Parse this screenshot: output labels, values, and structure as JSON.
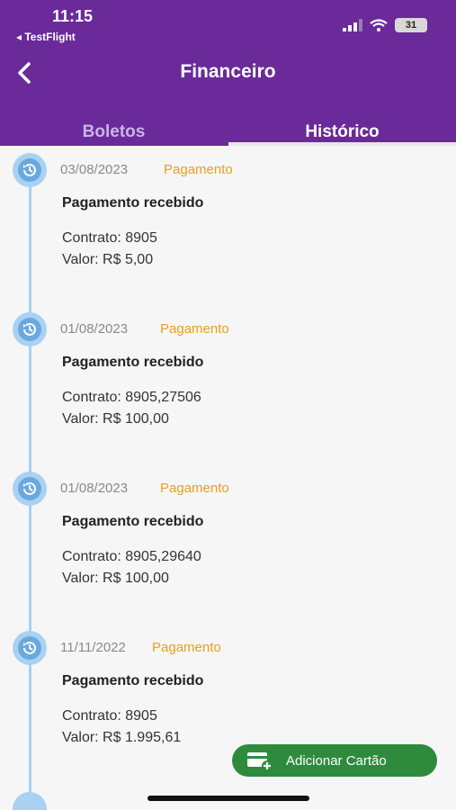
{
  "status_bar": {
    "time": "11:15",
    "back_app": "◂ TestFlight",
    "battery": "31"
  },
  "header": {
    "title": "Financeiro",
    "back_icon": "chevron-left-icon"
  },
  "tabs": [
    {
      "label": "Boletos",
      "selected": false
    },
    {
      "label": "Histórico",
      "selected": true
    }
  ],
  "entries": [
    {
      "date": "03/08/2023",
      "type": "Pagamento",
      "heading": "Pagamento recebido",
      "contrato": "Contrato: 8905",
      "valor": "Valor: R$ 5,00"
    },
    {
      "date": "01/08/2023",
      "type": "Pagamento",
      "heading": "Pagamento recebido",
      "contrato": "Contrato: 8905,27506",
      "valor": "Valor: R$ 100,00"
    },
    {
      "date": "01/08/2023",
      "type": "Pagamento",
      "heading": "Pagamento recebido",
      "contrato": "Contrato: 8905,29640",
      "valor": "Valor: R$ 100,00"
    },
    {
      "date": "11/11/2022",
      "type": "Pagamento",
      "heading": "Pagamento recebido",
      "contrato": "Contrato: 8905",
      "valor": "Valor: R$ 1.995,61"
    }
  ],
  "fab": {
    "label": "Adicionar Cartão",
    "icon": "add-card-icon"
  },
  "colors": {
    "header": "#6a2a9a",
    "accent": "#e6a01e",
    "timeline": "#a9d1f2",
    "fab": "#2e8b3e"
  }
}
